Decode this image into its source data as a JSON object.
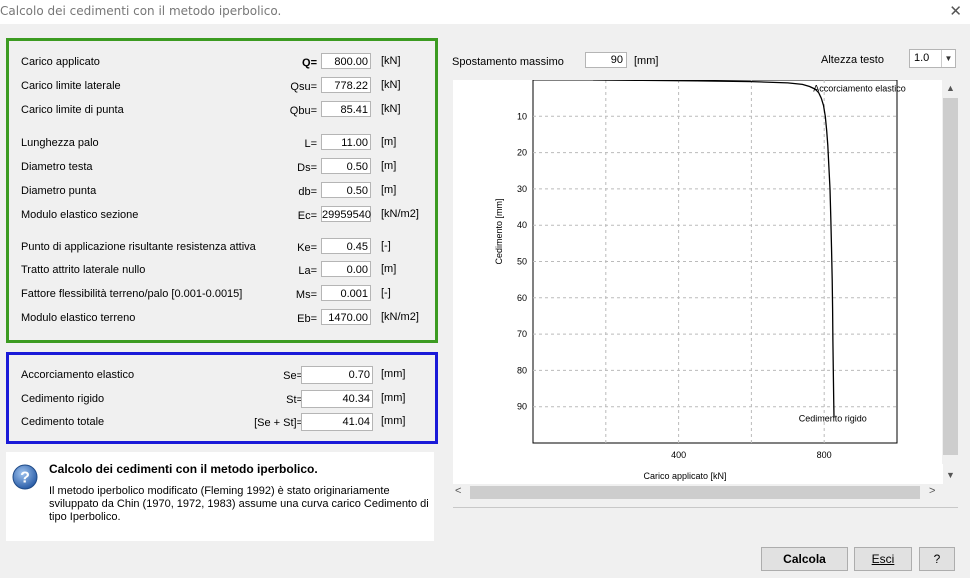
{
  "window": {
    "title": "Calcolo dei cedimenti con il metodo iperbolico.",
    "close_glyph": "✕"
  },
  "params": [
    {
      "label": "Carico applicato",
      "symbol": "Q=",
      "value": "800.00",
      "unit": "[kN]"
    },
    {
      "label": "Carico limite laterale",
      "symbol": "Qsu=",
      "value": "778.22",
      "unit": "[kN]"
    },
    {
      "label": "Carico limite di punta",
      "symbol": "Qbu=",
      "value": "85.41",
      "unit": "[kN]"
    },
    {
      "label": "Lunghezza palo",
      "symbol": "L=",
      "value": "11.00",
      "unit": "[m]"
    },
    {
      "label": "Diametro testa",
      "symbol": "Ds=",
      "value": "0.50",
      "unit": "[m]"
    },
    {
      "label": "Diametro punta",
      "symbol": "db=",
      "value": "0.50",
      "unit": "[m]"
    },
    {
      "label": "Modulo elastico sezione",
      "symbol": "Ec=",
      "value": "29959540",
      "unit": "[kN/m2]"
    },
    {
      "label": "Punto di applicazione risultante resistenza attiva",
      "symbol": "Ke=",
      "value": "0.45",
      "unit": "[-]"
    },
    {
      "label": "Tratto attrito laterale nullo",
      "symbol": "La=",
      "value": "0.00",
      "unit": "[m]"
    },
    {
      "label": "Fattore flessibilità terreno/palo [0.001-0.0015]",
      "symbol": "Ms=",
      "value": "0.001",
      "unit": "[-]"
    },
    {
      "label": "Modulo elastico terreno",
      "symbol": "Eb=",
      "value": "1470.00",
      "unit": "[kN/m2]"
    }
  ],
  "results": [
    {
      "label": "Accorciamento elastico",
      "symbol": "Se=",
      "value": "0.70",
      "unit": "[mm]"
    },
    {
      "label": "Cedimento rigido",
      "symbol": "St=",
      "value": "40.34",
      "unit": "[mm]"
    },
    {
      "label": "Cedimento totale",
      "symbol": "[Se + St]=",
      "value": "41.04",
      "unit": "[mm]"
    }
  ],
  "info": {
    "title": "Calcolo dei cedimenti con il metodo iperbolico.",
    "text": "Il metodo iperbolico modificato (Fleming 1992) è stato originariamente sviluppato da Chin (1970, 1972, 1983)  assume una curva carico Cedimento di tipo Iperbolico.",
    "icon": "question-icon"
  },
  "chart_controls": {
    "spostamento_label": "Spostamento massimo",
    "spostamento_value": "90",
    "spostamento_unit": "[mm]",
    "altezza_label": "Altezza testo",
    "altezza_value": "1.0"
  },
  "chart_data": {
    "type": "line",
    "xlabel": "Carico applicato [kN]",
    "ylabel": "Cedimento [mm]",
    "xlim": [
      0,
      1000
    ],
    "ylim": [
      0,
      100
    ],
    "y_inverted": true,
    "grid": true,
    "xticks": [
      400,
      800
    ],
    "yticks": [
      10,
      20,
      30,
      40,
      50,
      60,
      70,
      80,
      90
    ],
    "series": [
      {
        "x": [
          165,
          300,
          450,
          600,
          700,
          740,
          760,
          775,
          785,
          792,
          798,
          803,
          807,
          810,
          813,
          816,
          818,
          820,
          822,
          823,
          824,
          825,
          826,
          827
        ],
        "y": [
          0,
          0.1,
          0.25,
          0.45,
          0.8,
          1.2,
          1.8,
          2.5,
          3.5,
          5,
          7,
          10,
          14,
          18,
          24,
          30,
          38,
          46,
          55,
          63,
          72,
          80,
          88,
          93
        ]
      }
    ],
    "annotations": [
      {
        "text": "Accorciamento elastico",
        "x": 770,
        "y": 2
      },
      {
        "text": "Cedimento rigido",
        "x": 730,
        "y": 93
      }
    ]
  },
  "buttons": {
    "calcola": "Calcola",
    "esci": "Esci",
    "help": "?"
  }
}
